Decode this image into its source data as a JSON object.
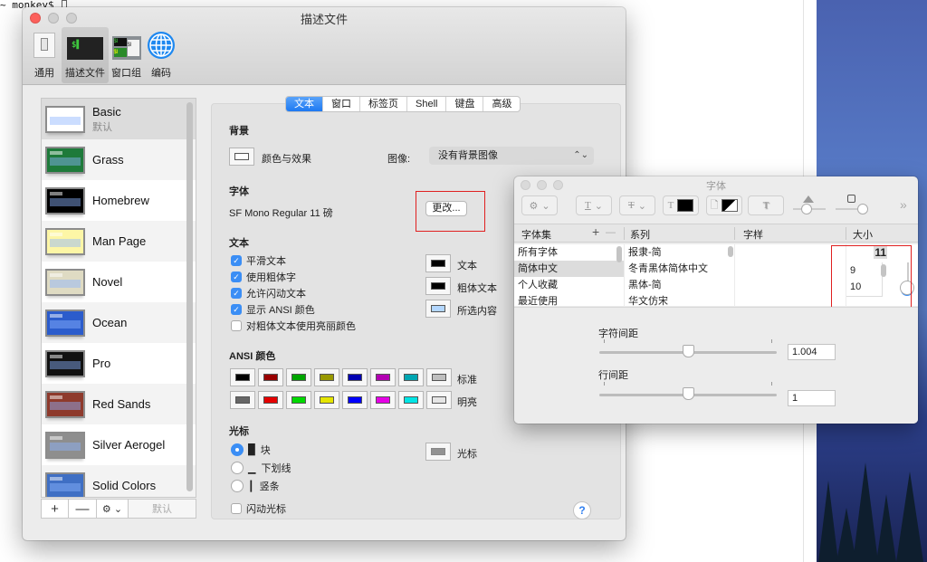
{
  "terminal": {
    "prompt": "~ monkey$ "
  },
  "prefs_window": {
    "title": "描述文件",
    "toolbar": [
      {
        "label": "通用",
        "icon": "general-switch-icon"
      },
      {
        "label": "描述文件",
        "icon": "terminal-profile-icon",
        "active": true
      },
      {
        "label": "窗口组",
        "icon": "window-groups-icon"
      },
      {
        "label": "编码",
        "icon": "globe-icon"
      }
    ],
    "profiles": [
      {
        "name": "Basic",
        "subtitle": "默认",
        "thumb_bg": "#ffffff",
        "selected": true
      },
      {
        "name": "Grass",
        "thumb_bg": "#1e7a3a"
      },
      {
        "name": "Homebrew",
        "thumb_bg": "#000000"
      },
      {
        "name": "Man Page",
        "thumb_bg": "#fdf6a6"
      },
      {
        "name": "Novel",
        "thumb_bg": "#dfdbc3"
      },
      {
        "name": "Ocean",
        "thumb_bg": "#2b5ccc"
      },
      {
        "name": "Pro",
        "thumb_bg": "#111111"
      },
      {
        "name": "Red Sands",
        "thumb_bg": "#8e3a2c"
      },
      {
        "name": "Silver Aerogel",
        "thumb_bg": "#8e8e8e"
      },
      {
        "name": "Solid Colors",
        "thumb_bg": "#3f6fc4"
      }
    ],
    "list_footer": {
      "add": "+",
      "remove": "—",
      "gear": "⚙ ⌄",
      "default": "默认"
    },
    "tabs": [
      {
        "label": "文本",
        "active": true
      },
      {
        "label": "窗口"
      },
      {
        "label": "标签页"
      },
      {
        "label": "Shell"
      },
      {
        "label": "键盘"
      },
      {
        "label": "高级"
      }
    ],
    "background": {
      "section": "背景",
      "color_effects": "颜色与效果",
      "image_label": "图像:",
      "image_value": "没有背景图像"
    },
    "font": {
      "section": "字体",
      "value": "SF Mono Regular 11 磅",
      "change_button": "更改..."
    },
    "text": {
      "section": "文本",
      "options": [
        {
          "label": "平滑文本",
          "checked": true
        },
        {
          "label": "使用粗体字",
          "checked": true
        },
        {
          "label": "允许闪动文本",
          "checked": true
        },
        {
          "label": "显示 ANSI 颜色",
          "checked": true
        },
        {
          "label": "对粗体文本使用亮丽颜色",
          "checked": false
        }
      ],
      "colors": [
        {
          "label": "文本",
          "color": "#000000"
        },
        {
          "label": "粗体文本",
          "color": "#000000"
        },
        {
          "label": "所选内容",
          "color": "#b3d7ff"
        }
      ]
    },
    "ansi": {
      "section": "ANSI 颜色",
      "normal_label": "标准",
      "bright_label": "明亮",
      "normal": [
        "#000000",
        "#990000",
        "#00a600",
        "#999900",
        "#0000b2",
        "#b200b2",
        "#00a6b2",
        "#bfbfbf"
      ],
      "bright": [
        "#666666",
        "#e50000",
        "#00d900",
        "#e5e500",
        "#0000ff",
        "#e500e5",
        "#00e5e5",
        "#e5e5e5"
      ]
    },
    "cursor": {
      "section": "光标",
      "options": [
        {
          "glyph": "█",
          "label": "块",
          "selected": true
        },
        {
          "glyph": "▁",
          "label": "下划线",
          "selected": false
        },
        {
          "glyph": "┃",
          "label": "竖条",
          "selected": false
        }
      ],
      "blink_label": "闪动光标",
      "blink_checked": false,
      "color_label": "光标",
      "color": "#929292"
    },
    "help": "?"
  },
  "font_panel": {
    "title": "字体",
    "columns": {
      "collections": "字体集",
      "family": "系列",
      "typeface": "字样",
      "size": "大小",
      "add": "+",
      "remove": "—"
    },
    "collections": [
      {
        "label": "所有字体"
      },
      {
        "label": "简体中文",
        "selected": true
      },
      {
        "label": "个人收藏"
      },
      {
        "label": "最近使用"
      }
    ],
    "families": [
      "报隶-简",
      "冬青黑体简体中文",
      "黑体-简",
      "华文仿宋"
    ],
    "size_value": "11",
    "sizes": [
      "9",
      "10"
    ],
    "char_spacing_label": "字符间距",
    "char_spacing_value": "1.004",
    "char_spacing_position": 0.5,
    "line_spacing_label": "行间距",
    "line_spacing_value": "1",
    "line_spacing_position": 0.5,
    "more": "»"
  }
}
